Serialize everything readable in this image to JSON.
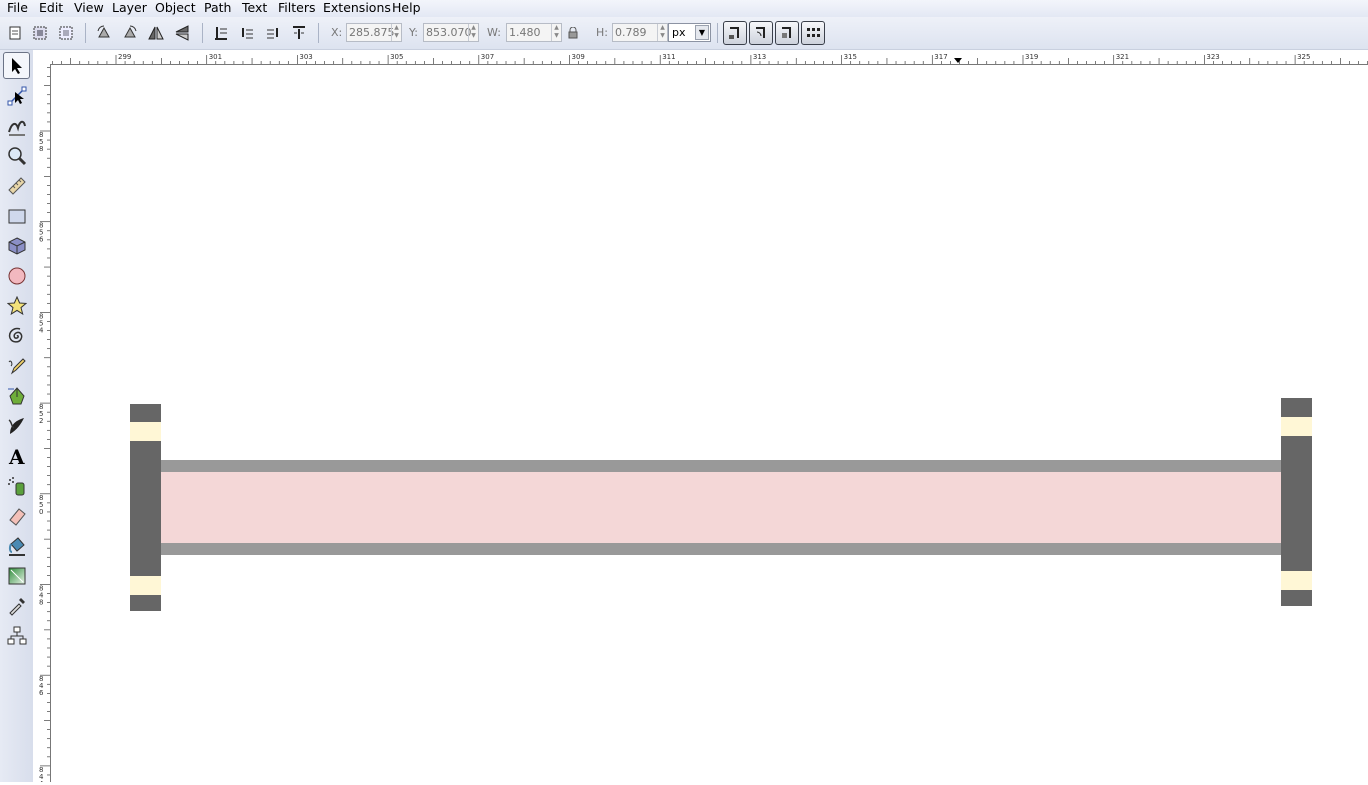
{
  "menu": [
    "File",
    "Edit",
    "View",
    "Layer",
    "Object",
    "Path",
    "Text",
    "Filters",
    "Extensions",
    "Help"
  ],
  "toolbar": {
    "x_label": "X:",
    "x_value": "285.875",
    "y_label": "Y:",
    "y_value": "853.070",
    "w_label": "W:",
    "w_value": "1.480",
    "h_label": "H:",
    "h_value": "0.789",
    "unit": "px",
    "icons": [
      "select-all-in-layer-icon",
      "select-all-icon",
      "deselect-icon",
      "rotate-ccw-icon",
      "rotate-cw-icon",
      "flip-horizontal-icon",
      "flip-vertical-icon",
      "lower-to-bottom-icon",
      "lower-icon",
      "raise-icon",
      "raise-to-top-icon",
      "lock-icon"
    ],
    "snap_icons": [
      "snap-stroke-icon",
      "snap-corners-icon",
      "snap-gradients-icon",
      "snap-grid-icon"
    ]
  },
  "tools": [
    "selector-tool",
    "node-tool",
    "tweak-tool",
    "zoom-tool",
    "measure-tool",
    "rectangle-tool",
    "3d-box-tool",
    "ellipse-tool",
    "star-tool",
    "spiral-tool",
    "pencil-tool",
    "pen-tool",
    "calligraphy-tool",
    "text-tool",
    "spray-tool",
    "eraser-tool",
    "paint-bucket-tool",
    "gradient-tool",
    "dropper-tool",
    "connector-tool"
  ],
  "hruler_labels": [
    "299",
    "301",
    "303",
    "305",
    "307",
    "309",
    "311",
    "313",
    "315",
    "317",
    "319",
    "321",
    "323",
    "325"
  ],
  "vruler_labels": [
    "858",
    "856",
    "854",
    "852",
    "850",
    "848",
    "846",
    "844"
  ],
  "colors": {
    "flange": "#666666",
    "flange_band": "#fff7d6",
    "rail": "#999999",
    "fill": "#f4d7d7"
  }
}
